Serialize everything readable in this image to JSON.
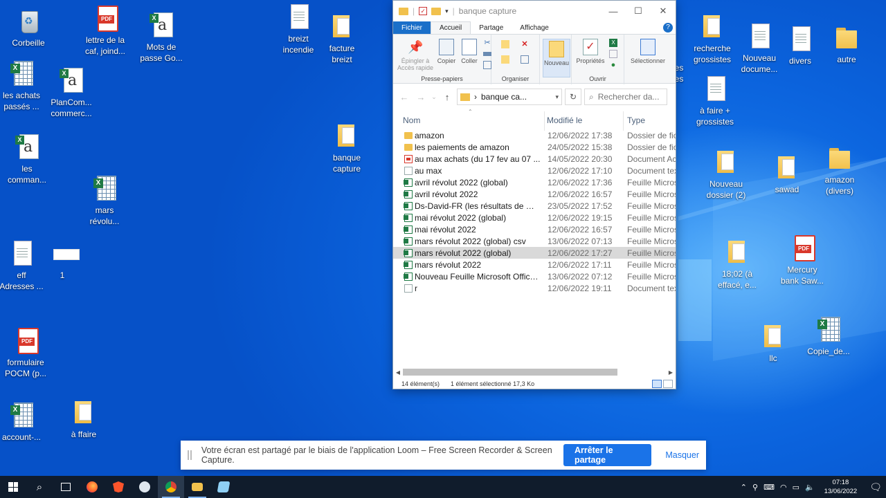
{
  "desktop": {
    "icons": [
      {
        "id": "corbeille",
        "label": "Corbeille",
        "type": "bin"
      },
      {
        "id": "lettre",
        "label": "lettre de la\ncaf, joind...",
        "type": "pdf"
      },
      {
        "id": "mots",
        "label": "Mots de\npasse Go...",
        "type": "text"
      },
      {
        "id": "breizt_incendie",
        "label": "breizt\nincendie",
        "type": "doc"
      },
      {
        "id": "facture_breizt",
        "label": "facture\nbreizt",
        "type": "folderdoc"
      },
      {
        "id": "achats",
        "label": "les achats\npassés ...",
        "type": "xls"
      },
      {
        "id": "plancom",
        "label": "PlanCom...\ncommerc...",
        "type": "text"
      },
      {
        "id": "banque_capture",
        "label": "banque\ncapture",
        "type": "folderdoc"
      },
      {
        "id": "comman",
        "label": "les\ncomman...",
        "type": "text"
      },
      {
        "id": "mars",
        "label": "mars\nrévolu...",
        "type": "xls"
      },
      {
        "id": "eff",
        "label": "eff\nAdresses ...",
        "type": "doc"
      },
      {
        "id": "one",
        "label": "1",
        "type": "img"
      },
      {
        "id": "formulaire",
        "label": "formulaire\nPOCM (p...",
        "type": "pdf"
      },
      {
        "id": "account",
        "label": "account-...",
        "type": "xls"
      },
      {
        "id": "affaire",
        "label": "à ffaire",
        "type": "folderdoc"
      },
      {
        "id": "es",
        "label": "es\nes",
        "type": "none"
      },
      {
        "id": "recherche",
        "label": "recherche\ngrossistes",
        "type": "folderdoc"
      },
      {
        "id": "nouveau_doc",
        "label": "Nouveau\ndocume...",
        "type": "doc"
      },
      {
        "id": "divers",
        "label": "divers",
        "type": "doc"
      },
      {
        "id": "autre",
        "label": "autre",
        "type": "folder"
      },
      {
        "id": "afaire",
        "label": "à faire +\ngrossistes",
        "type": "doc"
      },
      {
        "id": "nouveau_dossier",
        "label": "Nouveau\ndossier (2)",
        "type": "folderdoc"
      },
      {
        "id": "sawad",
        "label": "sawad",
        "type": "folderdoc"
      },
      {
        "id": "amazon_divers",
        "label": "amazon\n(divers)",
        "type": "folder"
      },
      {
        "id": "h1802",
        "label": "18;02 (à\neffacé, e...",
        "type": "folderdoc"
      },
      {
        "id": "mercury",
        "label": "Mercury\nbank Saw...",
        "type": "pdf"
      },
      {
        "id": "llc",
        "label": "llc",
        "type": "folderdoc"
      },
      {
        "id": "copie",
        "label": "Copie_de...",
        "type": "xls"
      }
    ]
  },
  "explorer": {
    "title": "banque capture",
    "window_controls": {
      "minimize": "—",
      "maximize": "☐",
      "close": "✕"
    },
    "tabs": {
      "file": "Fichier",
      "home": "Accueil",
      "share": "Partage",
      "view": "Affichage",
      "help": "?"
    },
    "ribbon": {
      "pin": "Épingler à\nAccès rapide",
      "copy": "Copier",
      "paste": "Coller",
      "clipboard_group": "Presse-papiers",
      "organize_group": "Organiser",
      "new": "Nouveau",
      "properties": "Propriétés",
      "open_group": "Ouvrir",
      "select": "Sélectionner"
    },
    "address": {
      "back": "←",
      "forward": "→",
      "recent": "⌄",
      "up": "↑",
      "separator": "›",
      "path": "banque ca...",
      "refresh": "↻",
      "search_placeholder": "Rechercher da..."
    },
    "columns": {
      "name": "Nom",
      "modified": "Modifié le",
      "type": "Type"
    },
    "files": [
      {
        "name": "amazon",
        "date": "12/06/2022 17:38",
        "type": "Dossier de fic",
        "icon": "folder"
      },
      {
        "name": "les paiements de amazon",
        "date": "24/05/2022 15:38",
        "type": "Dossier de fic",
        "icon": "folder"
      },
      {
        "name": "au max achats (du 17 fev au 07 ...",
        "date": "14/05/2022 20:30",
        "type": "Document Ac",
        "icon": "pdf"
      },
      {
        "name": "au max",
        "date": "12/06/2022 17:10",
        "type": "Document tex",
        "icon": "txt"
      },
      {
        "name": "avril révolut 2022 (global)",
        "date": "12/06/2022 17:36",
        "type": "Feuille Micros",
        "icon": "xls"
      },
      {
        "name": "avril révolut 2022",
        "date": "12/06/2022 16:57",
        "type": "Feuille Micros",
        "icon": "xls"
      },
      {
        "name": "Ds-David-FR (les résultats de mo...",
        "date": "23/05/2022 17:52",
        "type": "Feuille Micros",
        "icon": "xls"
      },
      {
        "name": "mai révolut 2022 (global)",
        "date": "12/06/2022 19:15",
        "type": "Feuille Micros",
        "icon": "xls"
      },
      {
        "name": "mai révolut 2022",
        "date": "12/06/2022 16:57",
        "type": "Feuille Micros",
        "icon": "xls"
      },
      {
        "name": "mars révolut 2022 (global) csv",
        "date": "13/06/2022 07:13",
        "type": "Feuille Micros",
        "icon": "xls"
      },
      {
        "name": "mars révolut 2022 (global)",
        "date": "12/06/2022 17:27",
        "type": "Feuille Micros",
        "icon": "xls",
        "selected": true
      },
      {
        "name": "mars révolut 2022",
        "date": "12/06/2022 17:11",
        "type": "Feuille Micros",
        "icon": "xls"
      },
      {
        "name": "Nouveau Feuille Microsoft Office...",
        "date": "13/06/2022 07:12",
        "type": "Feuille Micros",
        "icon": "xls"
      },
      {
        "name": "r",
        "date": "12/06/2022 19:11",
        "type": "Document tex",
        "icon": "txt"
      }
    ],
    "status": {
      "count": "14 élément(s)",
      "selection": "1 élément sélectionné  17,3 Ko"
    }
  },
  "loom": {
    "message": "Votre écran est partagé par le biais de l'application Loom – Free Screen Recorder & Screen Capture.",
    "stop": "Arrêter le partage",
    "hide": "Masquer"
  },
  "taskbar": {
    "apps": [
      "start",
      "search",
      "task-view",
      "firefox",
      "brave",
      "cloud-app",
      "chrome",
      "file-explorer",
      "notepad"
    ],
    "clock_time": "07:18",
    "clock_date": "13/06/2022",
    "tray_chevron": "⌃"
  }
}
